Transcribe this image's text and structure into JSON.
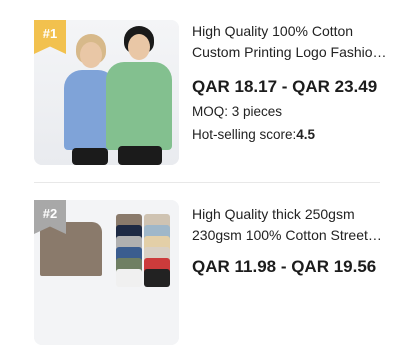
{
  "products": [
    {
      "rank": "#1",
      "title_line1": "High Quality 100% Cotton",
      "title_line2": "Custom Printing Logo Fashio…",
      "price": "QAR 18.17 - QAR 23.49",
      "moq": "MOQ: 3 pieces",
      "score_label": "Hot-selling score:",
      "score_value": "4.5"
    },
    {
      "rank": "#2",
      "title_line1": "High Quality thick 250gsm",
      "title_line2": "230gsm 100% Cotton Street…",
      "price": "QAR 11.98 - QAR 19.56"
    }
  ],
  "colors": {
    "rank_1": "#f2c14e",
    "rank_2": "#a8a8a8",
    "tee_colors": [
      "#8a7a6b",
      "#cfc3b2",
      "#1e2a44",
      "#9fb7c9",
      "#b0b0b0",
      "#e3cfa7",
      "#3b5d8f",
      "#d9d0c4",
      "#6f7f63",
      "#cc3b3b",
      "#f0f0f0",
      "#222222"
    ]
  }
}
